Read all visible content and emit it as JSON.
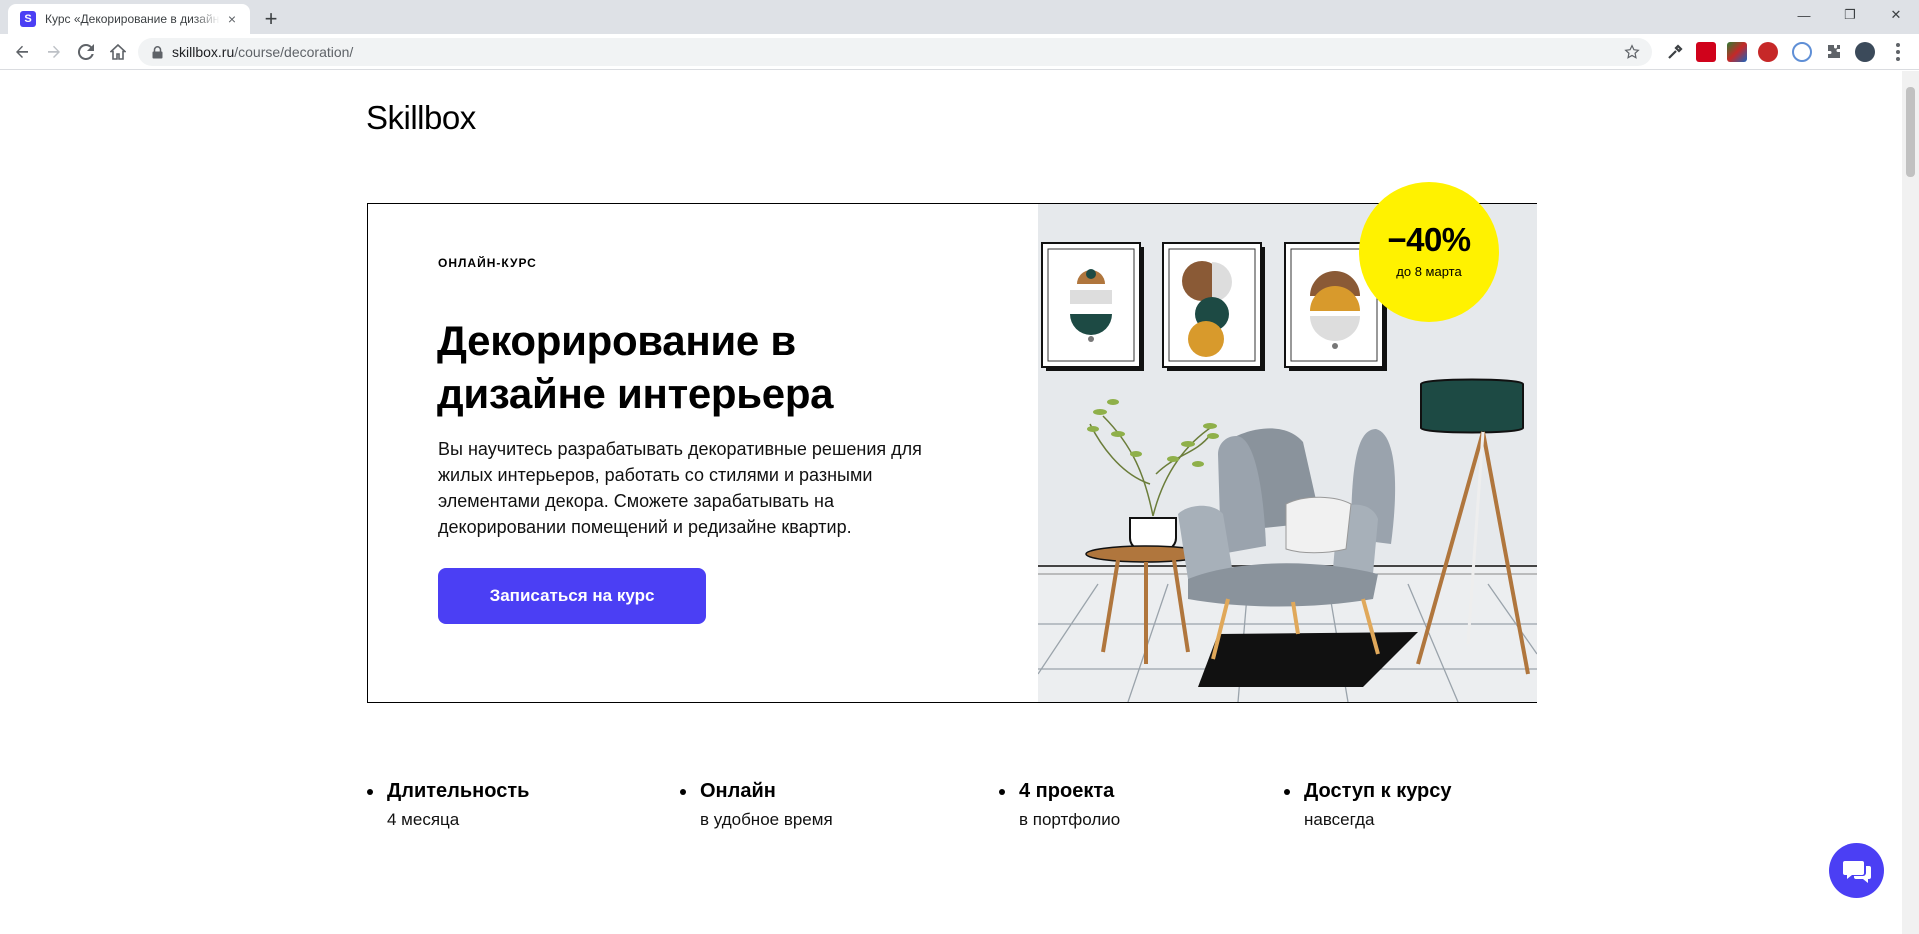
{
  "browser": {
    "tab_title": "Курс «Декорирование в дизайне интерьера»",
    "tab_favicon_letter": "S",
    "tab_close": "×",
    "new_tab": "+",
    "url_host": "skillbox.ru",
    "url_path": "/course/decoration/",
    "window_controls": [
      "—",
      "❐",
      "✕"
    ]
  },
  "page": {
    "logo": "Skillbox",
    "hero": {
      "label": "ОНЛАЙН-КУРС",
      "title": "Декорирование в дизайне интерьера",
      "description": "Вы научитесь разрабатывать декоративные решения для жилых интерьеров, работать со стилями и разными элементами декора. Сможете зарабатывать на декорировании помещений и редизайне квартир.",
      "cta_label": "Записаться на курс",
      "discount": "−40%",
      "discount_until": "до 8 марта"
    },
    "features": [
      {
        "title": "Длительность",
        "sub": "4 месяца"
      },
      {
        "title": "Онлайн",
        "sub": "в удобное время"
      },
      {
        "title": "4 проекта",
        "sub": "в портфолио"
      },
      {
        "title": "Доступ к курсу",
        "sub": "навсегда"
      }
    ]
  },
  "colors": {
    "accent": "#4b3ff4",
    "badge": "#fff200",
    "illustration_bg": "#e6e9ec"
  },
  "icons": [
    "back-arrow-icon",
    "forward-arrow-icon",
    "reload-icon",
    "home-icon",
    "lock-icon",
    "star-icon",
    "chat-icon"
  ]
}
